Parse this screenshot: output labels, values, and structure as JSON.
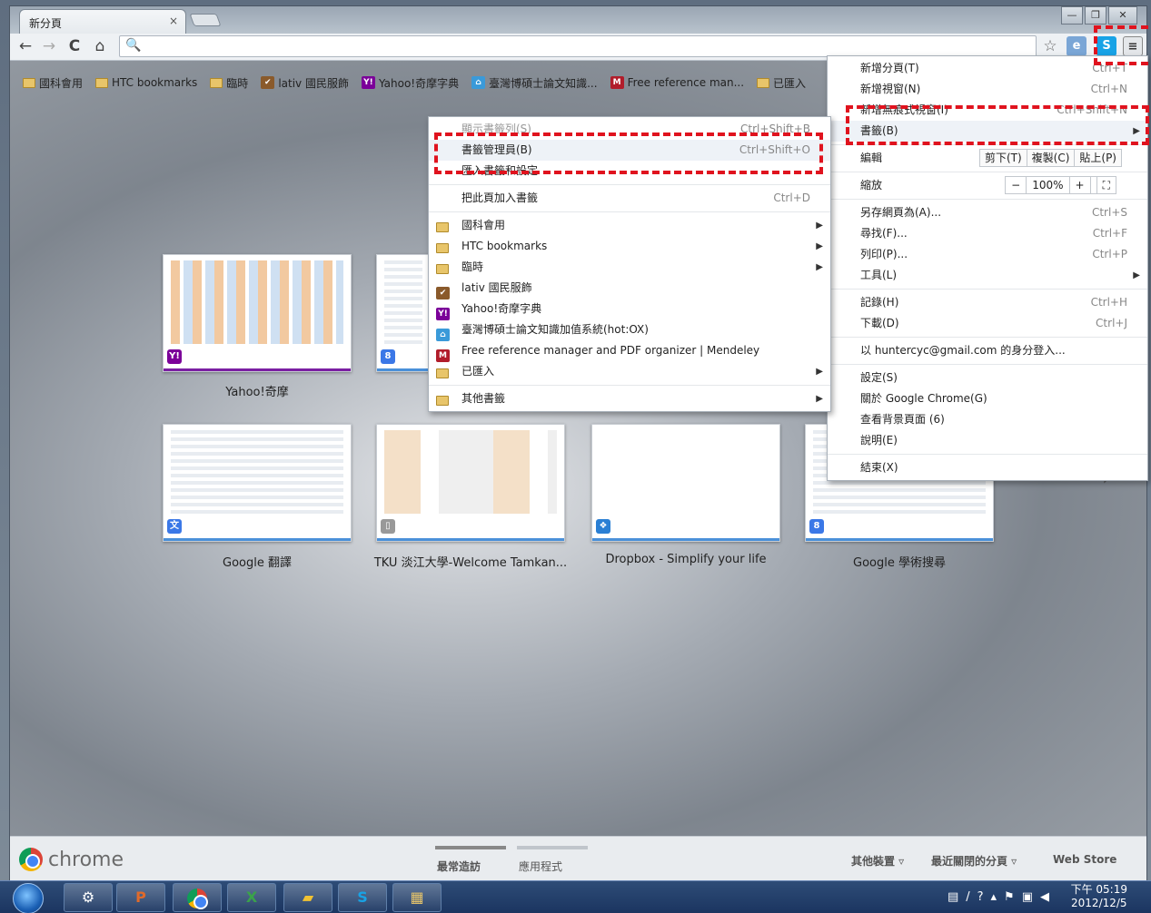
{
  "window": {
    "tab_title": "新分頁",
    "tab_close": "×",
    "win_min": "—",
    "win_max": "❐",
    "win_close": "✕"
  },
  "toolbar": {
    "back": "←",
    "forward": "→",
    "reload": "C",
    "home": "⌂",
    "search_glyph": "🔍",
    "address_value": "",
    "star": "☆"
  },
  "bookmarks_bar": [
    {
      "label": "國科會用",
      "icon": "folder-icon"
    },
    {
      "label": "HTC bookmarks",
      "icon": "folder-icon"
    },
    {
      "label": "臨時",
      "icon": "folder-icon"
    },
    {
      "label": "lativ 國民服飾",
      "icon": "lativ-icon"
    },
    {
      "label": "Yahoo!奇摩字典",
      "icon": "yahoo-icon"
    },
    {
      "label": "臺灣博碩士論文知識...",
      "icon": "ndltd-icon"
    },
    {
      "label": "Free reference man...",
      "icon": "mendeley-icon"
    },
    {
      "label": "已匯入",
      "icon": "folder-icon"
    }
  ],
  "thumbnails": [
    {
      "label": "Yahoo!奇摩",
      "fav": "Y!",
      "fav_color": "#7b0099",
      "bar_color": "#7b1fa2"
    },
    {
      "label": "",
      "fav": "8",
      "fav_color": "#3b78e7",
      "bar_color": "#4a90d9"
    },
    {
      "label": "Google 翻譯",
      "fav": "文",
      "fav_color": "#3b78e7",
      "bar_color": "#4a90d9"
    },
    {
      "label": "TKU 淡江大學-Welcome Tamkan...",
      "fav": "▯",
      "fav_color": "#999999",
      "bar_color": "#4a90d9"
    },
    {
      "label": "Dropbox - Simplify your life",
      "fav": "❖",
      "fav_color": "#2a7fd4",
      "bar_color": "#4a90d9"
    },
    {
      "label": "Google 學術搜尋",
      "fav": "8",
      "fav_color": "#3b78e7",
      "bar_color": "#4a90d9"
    }
  ],
  "footer": {
    "brand": "chrome",
    "tab_most_visited": "最常造訪",
    "tab_apps": "應用程式",
    "other_devices": "其他裝置 ▿",
    "recently_closed": "最近關閉的分頁 ▿",
    "web_store": "Web Store"
  },
  "main_menu": {
    "new_tab": "新增分頁(T)",
    "new_tab_sc": "Ctrl+T",
    "new_window": "新增視窗(N)",
    "new_window_sc": "Ctrl+N",
    "new_incognito": "新增無痕式視窗(I)",
    "new_incognito_sc": "Ctrl+Shift+N",
    "bookmarks": "書籤(B)",
    "edit": "編輯",
    "cut": "剪下(T)",
    "copy": "複製(C)",
    "paste": "貼上(P)",
    "zoom": "縮放",
    "zoom_minus": "−",
    "zoom_value": "100%",
    "zoom_plus": "+",
    "fullscreen": "⛶",
    "save_as": "另存網頁為(A)...",
    "save_as_sc": "Ctrl+S",
    "find": "尋找(F)...",
    "find_sc": "Ctrl+F",
    "print": "列印(P)...",
    "print_sc": "Ctrl+P",
    "tools": "工具(L)",
    "history": "記錄(H)",
    "history_sc": "Ctrl+H",
    "downloads": "下載(D)",
    "downloads_sc": "Ctrl+J",
    "signin": "以 huntercyc@gmail.com 的身分登入...",
    "settings": "設定(S)",
    "about": "關於 Google Chrome(G)",
    "background_pages": "查看背景頁面 (6)",
    "help": "說明(E)",
    "exit": "結束(X)"
  },
  "bookmarks_menu": {
    "show_bar": "顯示書籤列(S)",
    "show_bar_sc": "Ctrl+Shift+B",
    "manager": "書籤管理員(B)",
    "manager_sc": "Ctrl+Shift+O",
    "import": "匯入書籤和設定",
    "bookmark_page": "把此頁加入書籤",
    "bookmark_page_sc": "Ctrl+D",
    "items": [
      {
        "label": "國科會用",
        "icon": "folder-icon",
        "submenu": true
      },
      {
        "label": "HTC bookmarks",
        "icon": "folder-icon",
        "submenu": true
      },
      {
        "label": "臨時",
        "icon": "folder-icon",
        "submenu": true
      },
      {
        "label": "lativ 國民服飾",
        "icon": "lativ-icon",
        "submenu": false
      },
      {
        "label": "Yahoo!奇摩字典",
        "icon": "yahoo-icon",
        "submenu": false
      },
      {
        "label": "臺灣博碩士論文知識加值系統(hot:OX)",
        "icon": "ndltd-icon",
        "submenu": false
      },
      {
        "label": "Free reference manager and PDF organizer | Mendeley",
        "icon": "mendeley-icon",
        "submenu": false
      },
      {
        "label": "已匯入",
        "icon": "folder-icon",
        "submenu": true
      }
    ],
    "other": "其他書籤"
  },
  "taskbar": {
    "time": "下午 05:19",
    "date": "2012/12/5"
  },
  "colors": {
    "highlight_dash": "#e0131e",
    "folder": "#e8c56a"
  }
}
